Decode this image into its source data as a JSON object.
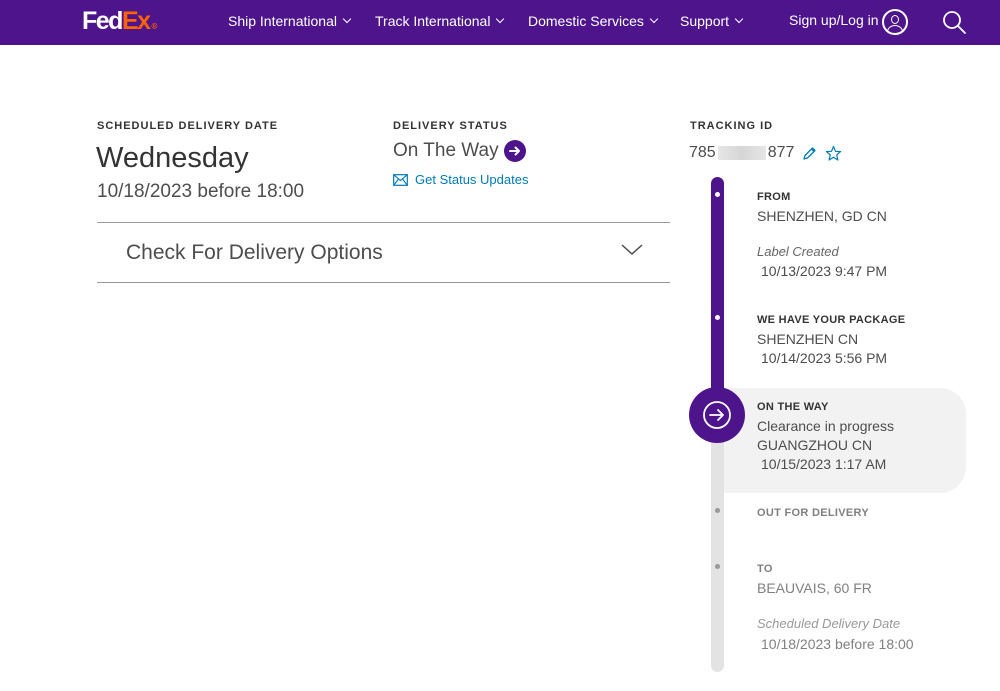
{
  "header": {
    "logo": {
      "part1": "Fed",
      "part2": "Ex",
      "mark": "®"
    },
    "nav": [
      {
        "label": "Ship International",
        "icon": "chevron-down-icon"
      },
      {
        "label": "Track International",
        "icon": "chevron-down-icon"
      },
      {
        "label": "Domestic Services",
        "icon": "chevron-down-icon"
      },
      {
        "label": "Support",
        "icon": "chevron-down-icon"
      }
    ],
    "signin_label": "Sign up/Log in",
    "user_icon": "user-icon",
    "search_icon": "search-icon",
    "brand_color": "#4d148c",
    "accent_color": "#ff6200"
  },
  "delivery": {
    "scheduled_label": "SCHEDULED DELIVERY DATE",
    "scheduled_day": "Wednesday",
    "scheduled_date": "10/18/2023 before 18:00",
    "status_label": "DELIVERY STATUS",
    "status_value": "On The Way",
    "status_updates_link": "Get Status Updates",
    "tracking_label": "TRACKING ID",
    "tracking_prefix": "785",
    "tracking_suffix": "877",
    "options_label": "Check For Delivery Options"
  },
  "timeline": {
    "from": {
      "heading": "FROM",
      "location": "SHENZHEN, GD CN",
      "note": "Label Created",
      "datetime": "10/13/2023 9:47 PM"
    },
    "picked_up": {
      "heading": "WE HAVE YOUR PACKAGE",
      "location": "SHENZHEN CN",
      "datetime": "10/14/2023 5:56 PM"
    },
    "current": {
      "heading": "ON THE WAY",
      "status": "Clearance in progress",
      "location": "GUANGZHOU CN",
      "datetime": "10/15/2023 1:17 AM"
    },
    "out_for_delivery": {
      "heading": "OUT FOR DELIVERY"
    },
    "to": {
      "heading": "TO",
      "location": "BEAUVAIS, 60 FR",
      "note": "Scheduled Delivery Date",
      "datetime": "10/18/2023 before 18:00"
    }
  }
}
